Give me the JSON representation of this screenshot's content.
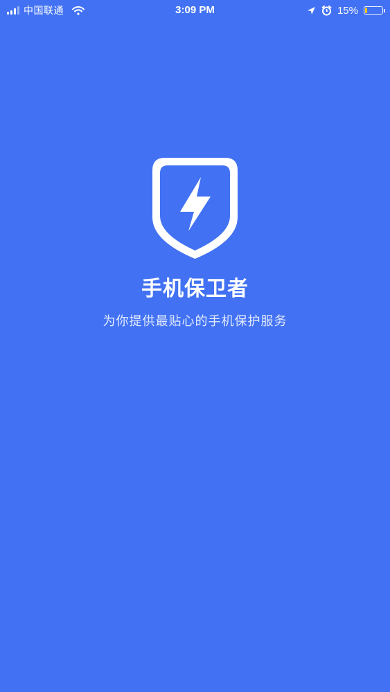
{
  "status_bar": {
    "carrier": "中国联通",
    "time": "3:09 PM",
    "battery_percent": "15%",
    "battery_level": 0.15,
    "icons": [
      "signal-icon",
      "wifi-icon",
      "location-arrow-icon",
      "alarm-icon",
      "battery-icon"
    ]
  },
  "app": {
    "logo_icon": "shield-lightning-icon",
    "title": "手机保卫者",
    "subtitle": "为你提供最贴心的手机保护服务"
  },
  "colors": {
    "background": "#4272F3",
    "text": "#FFFFFF",
    "battery_fill": "#F5C518"
  }
}
